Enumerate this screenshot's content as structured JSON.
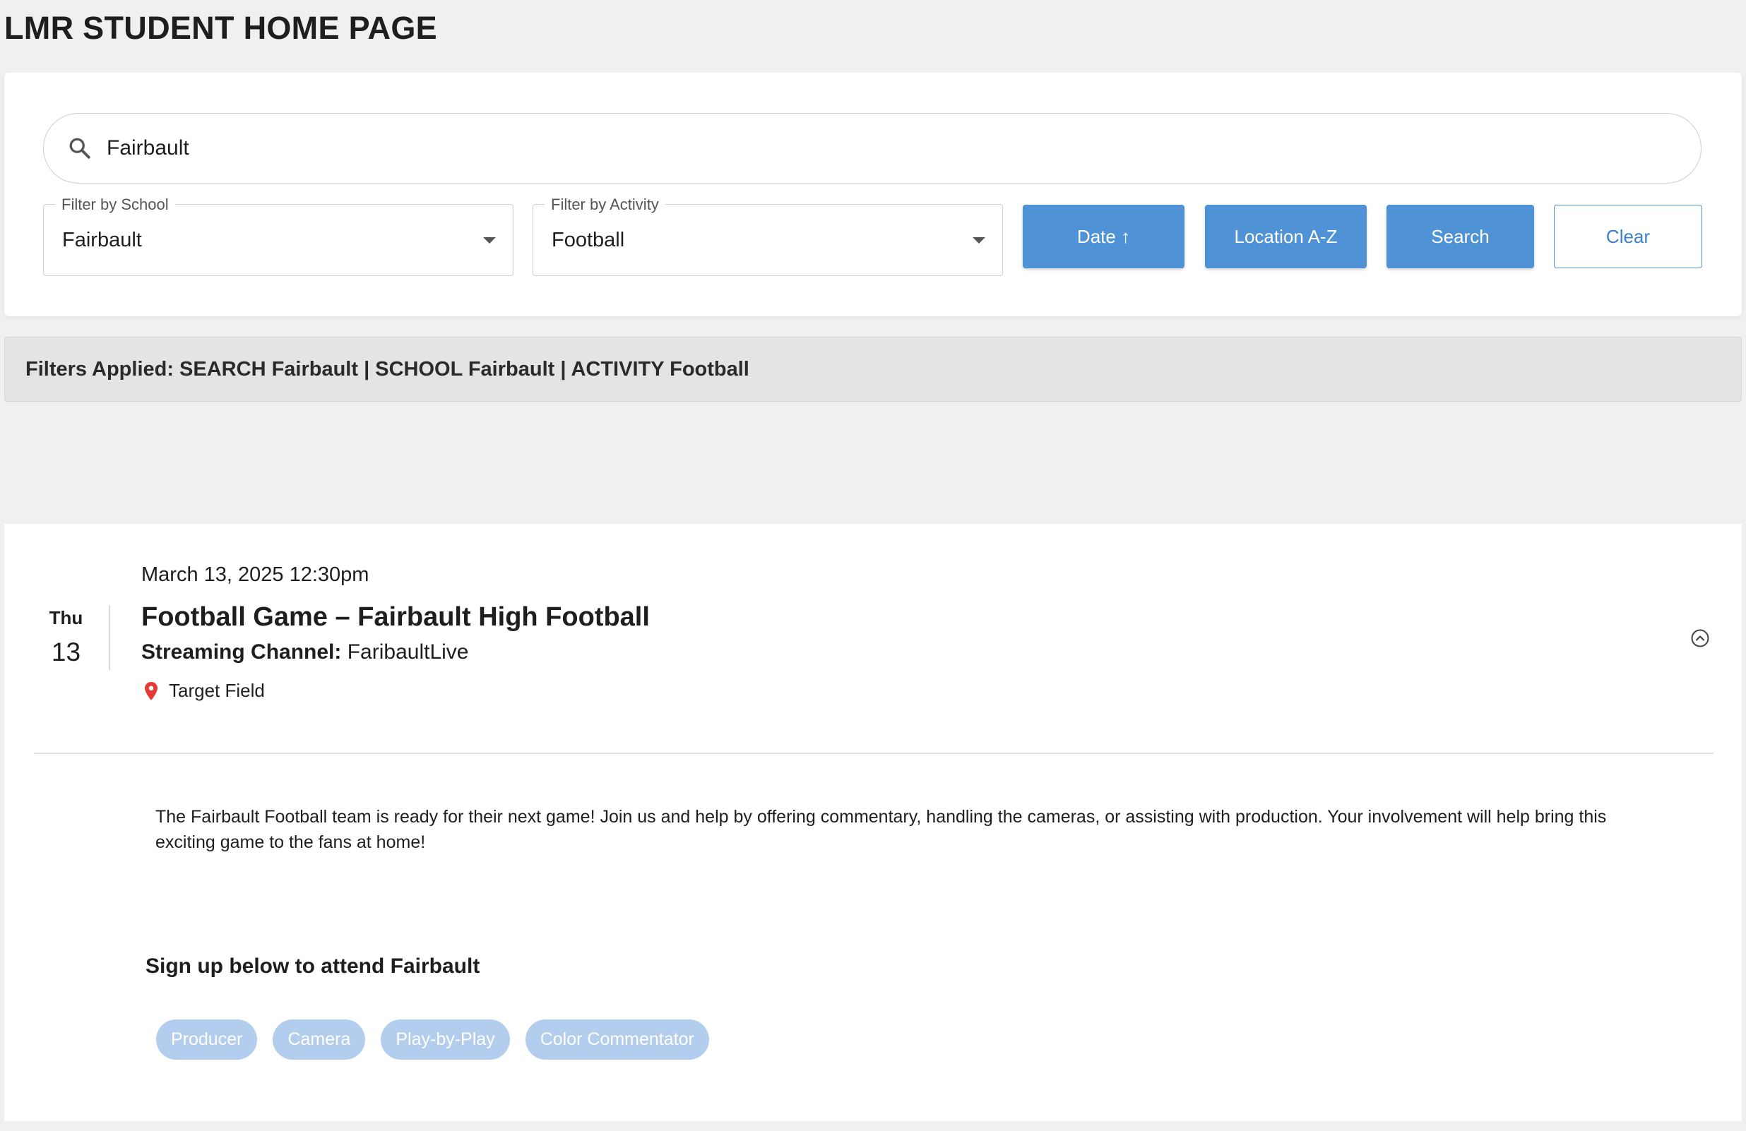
{
  "page": {
    "title": "LMR STUDENT HOME PAGE"
  },
  "search": {
    "icon": "search-icon",
    "value": "Fairbault"
  },
  "filters": {
    "school": {
      "label": "Filter by School",
      "value": "Fairbault"
    },
    "activity": {
      "label": "Filter by Activity",
      "value": "Football"
    }
  },
  "buttons": {
    "date": "Date ↑",
    "location": "Location A-Z",
    "search": "Search",
    "clear": "Clear"
  },
  "applied_filters": "Filters Applied: SEARCH Fairbault | SCHOOL Fairbault | ACTIVITY Football",
  "event": {
    "day_name": "Thu",
    "day_number": "13",
    "datetime": "March 13, 2025 12:30pm",
    "title": "Football Game – Fairbault High Football",
    "channel_label": "Streaming Channel:",
    "channel_value": "FaribaultLive",
    "location_icon": "map-pin-icon",
    "location": "Target Field",
    "collapse_icon": "chevron-up-circle-icon",
    "description": "The Fairbault Football team is ready for their next game! Join us and help by offering commentary, handling the cameras, or assisting with production. Your involvement will help bring this exciting game to the fans at home!",
    "signup_heading": "Sign up below to attend Fairbault",
    "roles": [
      "Producer",
      "Camera",
      "Play-by-Play",
      "Color Commentator"
    ]
  },
  "colors": {
    "primary": "#4f93d6",
    "chip": "#b3cdef",
    "pin": "#e53935",
    "background": "#f0f0f0"
  }
}
